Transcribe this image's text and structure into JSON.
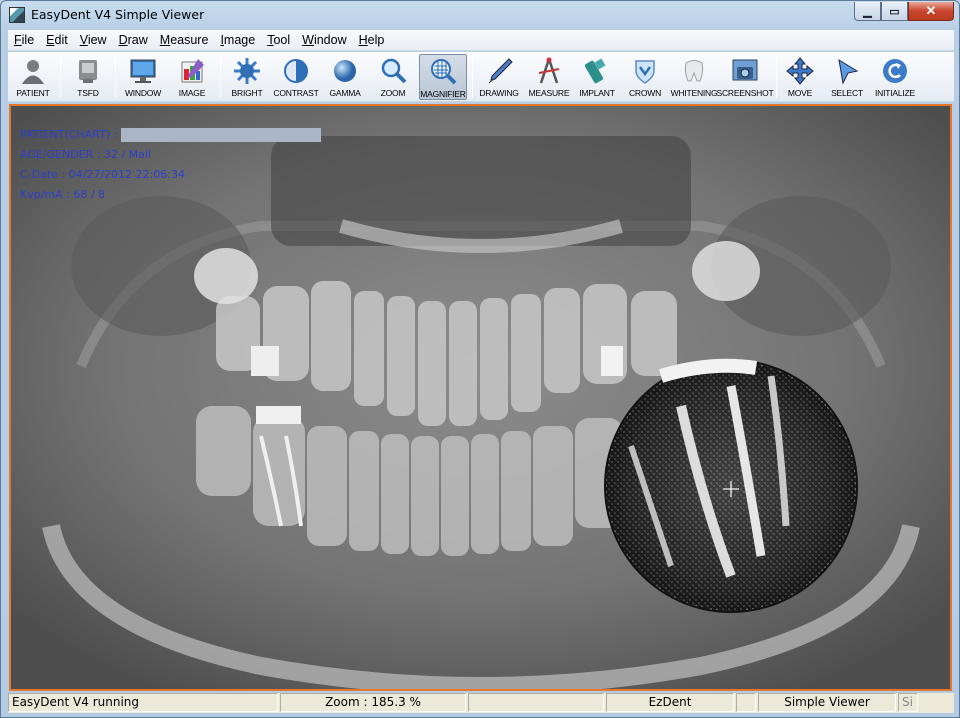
{
  "window": {
    "title": "EasyDent V4 Simple Viewer"
  },
  "menu": [
    {
      "label": "File",
      "key": "F",
      "rest": "ile"
    },
    {
      "label": "Edit",
      "key": "E",
      "rest": "dit"
    },
    {
      "label": "View",
      "key": "V",
      "rest": "iew"
    },
    {
      "label": "Draw",
      "key": "D",
      "rest": "raw"
    },
    {
      "label": "Measure",
      "key": "M",
      "rest": "easure"
    },
    {
      "label": "Image",
      "key": "I",
      "rest": "mage"
    },
    {
      "label": "Tool",
      "key": "T",
      "rest": "ool"
    },
    {
      "label": "Window",
      "key": "W",
      "rest": "indow"
    },
    {
      "label": "Help",
      "key": "H",
      "rest": "elp"
    }
  ],
  "toolbar": {
    "patient": "PATIENT",
    "tsfd": "TSFD",
    "window": "WINDOW",
    "image": "IMAGE",
    "bright": "BRIGHT",
    "contrast": "CONTRAST",
    "gamma": "GAMMA",
    "zoom": "ZOOM",
    "magnifier": "MAGNIFIER",
    "drawing": "DRAWING",
    "measure": "MEASURE",
    "implant": "IMPLANT",
    "crown": "CROWN",
    "whitening": "WHITENING",
    "screenshot": "SCREENSHOT",
    "move": "MOVE",
    "select": "SELECT",
    "initialize": "INITIALIZE"
  },
  "patient_info": {
    "chart": "PATIENT(CHART) :",
    "age_gender": "AGE/GENDER : 32 / Mail",
    "cdate": "C-Date : 04/27/2012 22:06:34",
    "kvp": "Kvp/mA :  68 /   8"
  },
  "statusbar": {
    "status": "EasyDent V4 running",
    "zoom": "Zoom : 185.3 %",
    "app": "EzDent",
    "mode": "Simple Viewer",
    "extra": "Si"
  },
  "colors": {
    "accent_border": "#e7762a",
    "info_text": "#2b3fcc"
  }
}
